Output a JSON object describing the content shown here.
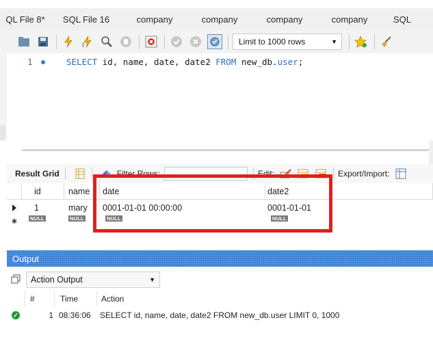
{
  "tabs": [
    "QL File 8*",
    "SQL File 16",
    "company",
    "company",
    "company",
    "company",
    "SQL"
  ],
  "toolbar": {
    "limit_value": "Limit to 1000 rows",
    "icons": [
      "folder-icon",
      "save-icon",
      "execute-icon",
      "execute-current-icon",
      "explain-icon",
      "stop-icon",
      "toggle-error-icon",
      "commit-icon",
      "rollback-icon",
      "autocommit-icon",
      "bookmark-icon",
      "beautify-icon"
    ]
  },
  "editor": {
    "line_number": "1",
    "sql_kw_select": "SELECT",
    "sql_cols": " id, name, date, date2 ",
    "sql_kw_from": "FROM",
    "sql_table_db": " new_db.",
    "sql_table": "user",
    "sql_end": ";"
  },
  "result_toolbar": {
    "result_grid_label": "Result Grid",
    "filter_rows_label": "Filter Rows:",
    "filter_value": "",
    "edit_label": "Edit:",
    "export_label": "Export/Import:"
  },
  "grid": {
    "columns": [
      "id",
      "name",
      "date",
      "date2"
    ],
    "rows": [
      [
        "1",
        "mary",
        "0001-01-01 00:00:00",
        "0001-01-01"
      ]
    ],
    "null_label": "NULL"
  },
  "output": {
    "title": "Output",
    "dropdown_value": "Action Output",
    "columns": [
      "#",
      "Time",
      "Action"
    ],
    "rows": [
      {
        "num": "1",
        "time": "08:36:06",
        "action": "SELECT id, name, date, date2 FROM new_db.user LIMIT 0, 1000"
      }
    ]
  },
  "colors": {
    "highlight_box": "#e02020",
    "output_header": "#3a82d6",
    "keyword": "#2c6cc4",
    "success": "#1f9a2f"
  }
}
